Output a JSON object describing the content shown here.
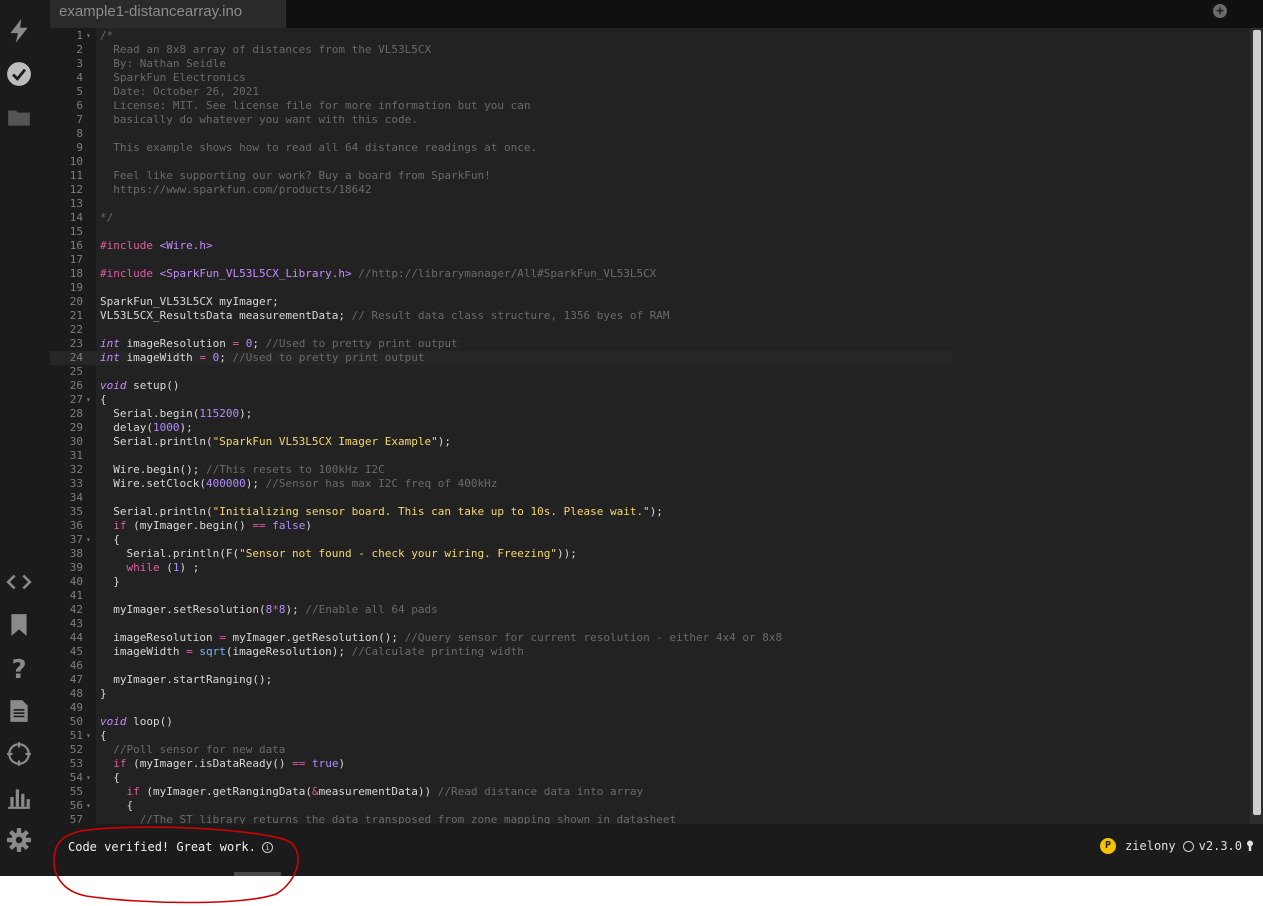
{
  "window": {
    "tab_name": "example1-distancearray.ino",
    "add_tab_label": "+"
  },
  "sidebar": {
    "top_icons": [
      "flash-icon",
      "verify-check-icon",
      "folder-icon"
    ],
    "bottom_icons": [
      "code-icon",
      "bookmark-icon",
      "help-icon",
      "document-icon",
      "target-icon",
      "bar-chart-icon",
      "gear-icon"
    ]
  },
  "editor": {
    "active_line": 24,
    "lines": [
      {
        "n": "1",
        "fold": true,
        "segs": [
          {
            "t": "/*",
            "c": "cm"
          }
        ]
      },
      {
        "n": "2",
        "segs": [
          {
            "t": "  Read an 8x8 array of distances from the VL53L5CX",
            "c": "cm"
          }
        ]
      },
      {
        "n": "3",
        "segs": [
          {
            "t": "  By: Nathan Seidle",
            "c": "cm"
          }
        ]
      },
      {
        "n": "4",
        "segs": [
          {
            "t": "  SparkFun Electronics",
            "c": "cm"
          }
        ]
      },
      {
        "n": "5",
        "segs": [
          {
            "t": "  Date: October 26, 2021",
            "c": "cm"
          }
        ]
      },
      {
        "n": "6",
        "segs": [
          {
            "t": "  License: MIT. See license file for more information but you can",
            "c": "cm"
          }
        ]
      },
      {
        "n": "7",
        "segs": [
          {
            "t": "  basically do whatever you want with this code.",
            "c": "cm"
          }
        ]
      },
      {
        "n": "8",
        "segs": []
      },
      {
        "n": "9",
        "segs": [
          {
            "t": "  This example shows how to read all 64 distance readings at once.",
            "c": "cm"
          }
        ]
      },
      {
        "n": "10",
        "segs": []
      },
      {
        "n": "11",
        "segs": [
          {
            "t": "  Feel like supporting our work? Buy a board from SparkFun!",
            "c": "cm"
          }
        ]
      },
      {
        "n": "12",
        "segs": [
          {
            "t": "  https://www.sparkfun.com/products/18642",
            "c": "cm"
          }
        ]
      },
      {
        "n": "13",
        "segs": []
      },
      {
        "n": "14",
        "segs": [
          {
            "t": "*/",
            "c": "cm"
          }
        ]
      },
      {
        "n": "15",
        "segs": []
      },
      {
        "n": "16",
        "segs": [
          {
            "t": "#include ",
            "c": "pp"
          },
          {
            "t": "<Wire.h>",
            "c": "inc"
          }
        ]
      },
      {
        "n": "17",
        "segs": []
      },
      {
        "n": "18",
        "segs": [
          {
            "t": "#include ",
            "c": "pp"
          },
          {
            "t": "<SparkFun_VL53L5CX_Library.h>",
            "c": "inc"
          },
          {
            "t": " //http://librarymanager/All#SparkFun_VL53L5CX",
            "c": "cm"
          }
        ]
      },
      {
        "n": "19",
        "segs": []
      },
      {
        "n": "20",
        "segs": [
          {
            "t": "SparkFun_VL53L5CX myImager;",
            "c": ""
          }
        ]
      },
      {
        "n": "21",
        "segs": [
          {
            "t": "VL53L5CX_ResultsData measurementData;",
            "c": ""
          },
          {
            "t": " // Result data class structure, 1356 byes of RAM",
            "c": "cm"
          }
        ]
      },
      {
        "n": "22",
        "segs": []
      },
      {
        "n": "23",
        "segs": [
          {
            "t": "int",
            "c": "kw"
          },
          {
            "t": " imageResolution ",
            "c": ""
          },
          {
            "t": "=",
            "c": "op"
          },
          {
            "t": " ",
            "c": ""
          },
          {
            "t": "0",
            "c": "num"
          },
          {
            "t": ";",
            "c": ""
          },
          {
            "t": " //Used to pretty print output",
            "c": "cm"
          }
        ]
      },
      {
        "n": "24",
        "segs": [
          {
            "t": "int",
            "c": "kw"
          },
          {
            "t": " imageWidth ",
            "c": ""
          },
          {
            "t": "=",
            "c": "op"
          },
          {
            "t": " ",
            "c": ""
          },
          {
            "t": "0",
            "c": "num"
          },
          {
            "t": ";",
            "c": ""
          },
          {
            "t": " //Used to pretty print output",
            "c": "cm"
          }
        ]
      },
      {
        "n": "25",
        "segs": []
      },
      {
        "n": "26",
        "segs": [
          {
            "t": "void",
            "c": "kw"
          },
          {
            "t": " setup()",
            "c": ""
          }
        ]
      },
      {
        "n": "27",
        "fold": true,
        "segs": [
          {
            "t": "{",
            "c": ""
          }
        ]
      },
      {
        "n": "28",
        "segs": [
          {
            "t": "  Serial.begin(",
            "c": ""
          },
          {
            "t": "115200",
            "c": "num"
          },
          {
            "t": ");",
            "c": ""
          }
        ]
      },
      {
        "n": "29",
        "segs": [
          {
            "t": "  delay(",
            "c": ""
          },
          {
            "t": "1000",
            "c": "num"
          },
          {
            "t": ");",
            "c": ""
          }
        ]
      },
      {
        "n": "30",
        "segs": [
          {
            "t": "  Serial.println(",
            "c": ""
          },
          {
            "t": "\"SparkFun VL53L5CX Imager Example\"",
            "c": "str"
          },
          {
            "t": ");",
            "c": ""
          }
        ]
      },
      {
        "n": "31",
        "segs": []
      },
      {
        "n": "32",
        "segs": [
          {
            "t": "  Wire.begin();",
            "c": ""
          },
          {
            "t": " //This resets to 100kHz I2C",
            "c": "cm"
          }
        ]
      },
      {
        "n": "33",
        "segs": [
          {
            "t": "  Wire.setClock(",
            "c": ""
          },
          {
            "t": "400000",
            "c": "num"
          },
          {
            "t": ");",
            "c": ""
          },
          {
            "t": " //Sensor has max I2C freq of 400kHz",
            "c": "cm"
          }
        ]
      },
      {
        "n": "34",
        "segs": []
      },
      {
        "n": "35",
        "segs": [
          {
            "t": "  Serial.println(",
            "c": ""
          },
          {
            "t": "\"Initializing sensor board. This can take up to 10s. Please wait.\"",
            "c": "str"
          },
          {
            "t": ");",
            "c": ""
          }
        ]
      },
      {
        "n": "36",
        "segs": [
          {
            "t": "  ",
            "c": ""
          },
          {
            "t": "if",
            "c": "kw2"
          },
          {
            "t": " (myImager.begin() ",
            "c": ""
          },
          {
            "t": "==",
            "c": "op"
          },
          {
            "t": " ",
            "c": ""
          },
          {
            "t": "false",
            "c": "num"
          },
          {
            "t": ")",
            "c": ""
          }
        ]
      },
      {
        "n": "37",
        "fold": true,
        "segs": [
          {
            "t": "  {",
            "c": ""
          }
        ]
      },
      {
        "n": "38",
        "segs": [
          {
            "t": "    Serial.println(F(",
            "c": ""
          },
          {
            "t": "\"Sensor not found - check your wiring. Freezing\"",
            "c": "str"
          },
          {
            "t": "));",
            "c": ""
          }
        ]
      },
      {
        "n": "39",
        "segs": [
          {
            "t": "    ",
            "c": ""
          },
          {
            "t": "while",
            "c": "kw2"
          },
          {
            "t": " (",
            "c": ""
          },
          {
            "t": "1",
            "c": "num"
          },
          {
            "t": ") ;",
            "c": ""
          }
        ]
      },
      {
        "n": "40",
        "segs": [
          {
            "t": "  }",
            "c": ""
          }
        ]
      },
      {
        "n": "41",
        "segs": []
      },
      {
        "n": "42",
        "segs": [
          {
            "t": "  myImager.setResolution(",
            "c": ""
          },
          {
            "t": "8",
            "c": "num"
          },
          {
            "t": "*",
            "c": "op"
          },
          {
            "t": "8",
            "c": "num"
          },
          {
            "t": ");",
            "c": ""
          },
          {
            "t": " //Enable all 64 pads",
            "c": "cm"
          }
        ]
      },
      {
        "n": "43",
        "segs": []
      },
      {
        "n": "44",
        "segs": [
          {
            "t": "  imageResolution ",
            "c": ""
          },
          {
            "t": "=",
            "c": "op"
          },
          {
            "t": " myImager.getResolution();",
            "c": ""
          },
          {
            "t": " //Query sensor for current resolution - either 4x4 or 8x8",
            "c": "cm"
          }
        ]
      },
      {
        "n": "45",
        "segs": [
          {
            "t": "  imageWidth ",
            "c": ""
          },
          {
            "t": "=",
            "c": "op"
          },
          {
            "t": " ",
            "c": ""
          },
          {
            "t": "sqrt",
            "c": "fn"
          },
          {
            "t": "(imageResolution);",
            "c": ""
          },
          {
            "t": " //Calculate printing width",
            "c": "cm"
          }
        ]
      },
      {
        "n": "46",
        "segs": []
      },
      {
        "n": "47",
        "segs": [
          {
            "t": "  myImager.startRanging();",
            "c": ""
          }
        ]
      },
      {
        "n": "48",
        "segs": [
          {
            "t": "}",
            "c": ""
          }
        ]
      },
      {
        "n": "49",
        "segs": []
      },
      {
        "n": "50",
        "segs": [
          {
            "t": "void",
            "c": "kw"
          },
          {
            "t": " loop()",
            "c": ""
          }
        ]
      },
      {
        "n": "51",
        "fold": true,
        "segs": [
          {
            "t": "{",
            "c": ""
          }
        ]
      },
      {
        "n": "52",
        "segs": [
          {
            "t": "  //Poll sensor for new data",
            "c": "cm"
          }
        ]
      },
      {
        "n": "53",
        "segs": [
          {
            "t": "  ",
            "c": ""
          },
          {
            "t": "if",
            "c": "kw2"
          },
          {
            "t": " (myImager.isDataReady() ",
            "c": ""
          },
          {
            "t": "==",
            "c": "op"
          },
          {
            "t": " ",
            "c": ""
          },
          {
            "t": "true",
            "c": "num"
          },
          {
            "t": ")",
            "c": ""
          }
        ]
      },
      {
        "n": "54",
        "fold": true,
        "segs": [
          {
            "t": "  {",
            "c": ""
          }
        ]
      },
      {
        "n": "55",
        "segs": [
          {
            "t": "    ",
            "c": ""
          },
          {
            "t": "if",
            "c": "kw2"
          },
          {
            "t": " (myImager.getRangingData(",
            "c": ""
          },
          {
            "t": "&",
            "c": "op"
          },
          {
            "t": "measurementData))",
            "c": ""
          },
          {
            "t": " //Read distance data into array",
            "c": "cm"
          }
        ]
      },
      {
        "n": "56",
        "fold": true,
        "segs": [
          {
            "t": "    {",
            "c": ""
          }
        ]
      },
      {
        "n": "57",
        "segs": [
          {
            "t": "      //The ST library returns the data transposed from zone mapping shown in datasheet",
            "c": "cm"
          }
        ]
      }
    ]
  },
  "status": {
    "message": "Code verified! Great work.",
    "info_symbol": "i",
    "device_initial": "P",
    "device_name": "zielony",
    "firmware_version": "v2.3.0"
  },
  "colors": {
    "annotation": "#d00000",
    "device_badge": "#f3c200",
    "background": "#222222"
  }
}
